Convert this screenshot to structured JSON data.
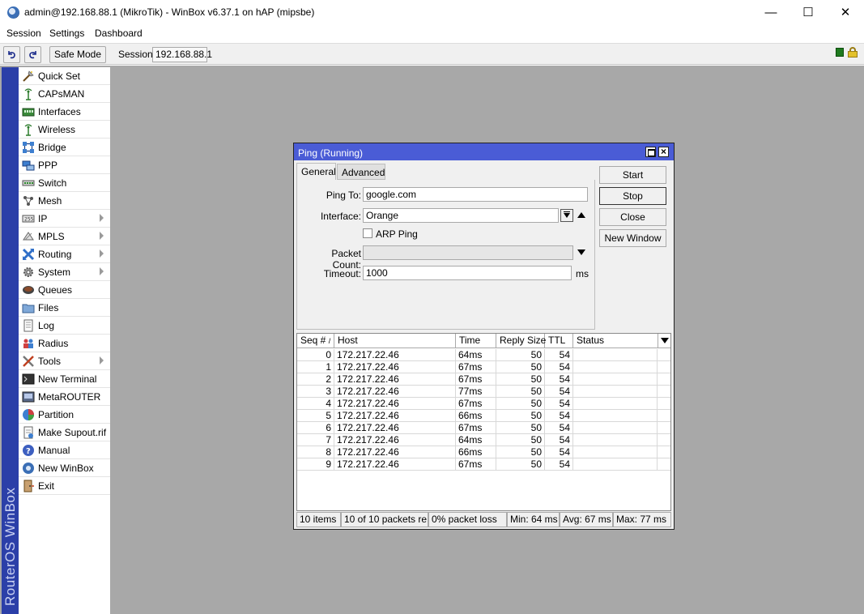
{
  "window": {
    "title": "admin@192.168.88.1 (MikroTik) - WinBox v6.37.1 on hAP (mipsbe)",
    "controls": {
      "minimize": "—",
      "maximize": "☐",
      "close": "✕"
    }
  },
  "menubar": {
    "items": [
      "Session",
      "Settings",
      "Dashboard"
    ]
  },
  "toolbar": {
    "undo_icon": "undo-icon",
    "redo_icon": "redo-icon",
    "safe_mode": "Safe Mode",
    "session_label": "Session:",
    "session_value": "192.168.88.1"
  },
  "brand": "RouterOS WinBox",
  "sidebar": {
    "items": [
      {
        "label": "Quick Set",
        "icon": "quick-set-icon",
        "submenu": false
      },
      {
        "label": "CAPsMAN",
        "icon": "antenna-icon",
        "submenu": false
      },
      {
        "label": "Interfaces",
        "icon": "interfaces-icon",
        "submenu": false
      },
      {
        "label": "Wireless",
        "icon": "wireless-icon",
        "submenu": false
      },
      {
        "label": "Bridge",
        "icon": "bridge-icon",
        "submenu": false
      },
      {
        "label": "PPP",
        "icon": "ppp-icon",
        "submenu": false
      },
      {
        "label": "Switch",
        "icon": "switch-icon",
        "submenu": false
      },
      {
        "label": "Mesh",
        "icon": "mesh-icon",
        "submenu": false
      },
      {
        "label": "IP",
        "icon": "ip-icon",
        "submenu": true
      },
      {
        "label": "MPLS",
        "icon": "mpls-icon",
        "submenu": true
      },
      {
        "label": "Routing",
        "icon": "routing-icon",
        "submenu": true
      },
      {
        "label": "System",
        "icon": "gear-icon",
        "submenu": true
      },
      {
        "label": "Queues",
        "icon": "queues-icon",
        "submenu": false
      },
      {
        "label": "Files",
        "icon": "folder-icon",
        "submenu": false
      },
      {
        "label": "Log",
        "icon": "log-icon",
        "submenu": false
      },
      {
        "label": "Radius",
        "icon": "radius-icon",
        "submenu": false
      },
      {
        "label": "Tools",
        "icon": "tools-icon",
        "submenu": true
      },
      {
        "label": "New Terminal",
        "icon": "terminal-icon",
        "submenu": false
      },
      {
        "label": "MetaROUTER",
        "icon": "metarouter-icon",
        "submenu": false
      },
      {
        "label": "Partition",
        "icon": "partition-icon",
        "submenu": false
      },
      {
        "label": "Make Supout.rif",
        "icon": "supout-icon",
        "submenu": false
      },
      {
        "label": "Manual",
        "icon": "help-icon",
        "submenu": false
      },
      {
        "label": "New WinBox",
        "icon": "winbox-icon",
        "submenu": false
      },
      {
        "label": "Exit",
        "icon": "exit-icon",
        "submenu": false
      }
    ]
  },
  "ping": {
    "title": "Ping (Running)",
    "tabs": [
      "General",
      "Advanced"
    ],
    "active_tab": "General",
    "fields": {
      "ping_to_label": "Ping To:",
      "ping_to_value": "google.com",
      "interface_label": "Interface:",
      "interface_value": "Orange",
      "arp_ping_label": "ARP Ping",
      "arp_ping_checked": false,
      "packet_count_label": "Packet Count:",
      "packet_count_value": "",
      "timeout_label": "Timeout:",
      "timeout_value": "1000",
      "timeout_unit": "ms"
    },
    "buttons": [
      "Start",
      "Stop",
      "Close",
      "New Window"
    ],
    "table": {
      "columns": [
        "Seq #",
        "Host",
        "Time",
        "Reply Size",
        "TTL",
        "Status"
      ],
      "rows": [
        {
          "seq": "0",
          "host": "172.217.22.46",
          "time": "64ms",
          "size": "50",
          "ttl": "54",
          "status": ""
        },
        {
          "seq": "1",
          "host": "172.217.22.46",
          "time": "67ms",
          "size": "50",
          "ttl": "54",
          "status": ""
        },
        {
          "seq": "2",
          "host": "172.217.22.46",
          "time": "67ms",
          "size": "50",
          "ttl": "54",
          "status": ""
        },
        {
          "seq": "3",
          "host": "172.217.22.46",
          "time": "77ms",
          "size": "50",
          "ttl": "54",
          "status": ""
        },
        {
          "seq": "4",
          "host": "172.217.22.46",
          "time": "67ms",
          "size": "50",
          "ttl": "54",
          "status": ""
        },
        {
          "seq": "5",
          "host": "172.217.22.46",
          "time": "66ms",
          "size": "50",
          "ttl": "54",
          "status": ""
        },
        {
          "seq": "6",
          "host": "172.217.22.46",
          "time": "67ms",
          "size": "50",
          "ttl": "54",
          "status": ""
        },
        {
          "seq": "7",
          "host": "172.217.22.46",
          "time": "64ms",
          "size": "50",
          "ttl": "54",
          "status": ""
        },
        {
          "seq": "8",
          "host": "172.217.22.46",
          "time": "66ms",
          "size": "50",
          "ttl": "54",
          "status": ""
        },
        {
          "seq": "9",
          "host": "172.217.22.46",
          "time": "67ms",
          "size": "50",
          "ttl": "54",
          "status": ""
        }
      ]
    },
    "status": {
      "items": "10 items",
      "packets": "10 of 10 packets re...",
      "loss": "0% packet loss",
      "min": "Min: 64 ms",
      "avg": "Avg: 67 ms",
      "max": "Max: 77 ms"
    }
  },
  "colors": {
    "workspace": "#a8a8a8",
    "brand_bar": "#2b3fa8",
    "window_title": "#4a5cd6",
    "connected_indicator": "#1f7a1f"
  }
}
